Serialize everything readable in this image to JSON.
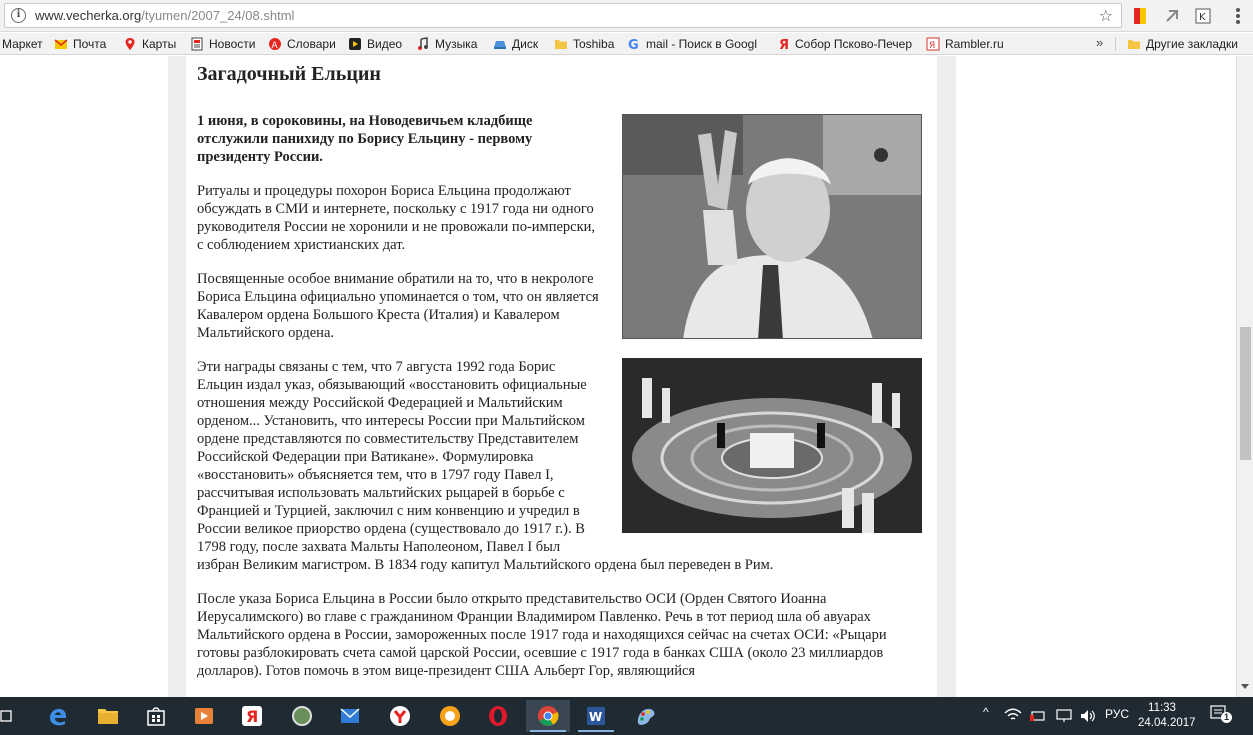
{
  "browser": {
    "url_host": "www.vecherka.org",
    "url_path": "/tyumen/2007_24/08.shtml"
  },
  "bookmarks": {
    "items": [
      {
        "label": "Маркет",
        "icon": "none"
      },
      {
        "label": "Почта",
        "icon": "mail-icon"
      },
      {
        "label": "Карты",
        "icon": "map-pin-icon"
      },
      {
        "label": "Новости",
        "icon": "news-icon"
      },
      {
        "label": "Словари",
        "icon": "dictionary-icon"
      },
      {
        "label": "Видео",
        "icon": "video-icon"
      },
      {
        "label": "Музыка",
        "icon": "music-icon"
      },
      {
        "label": "Диск",
        "icon": "disk-icon"
      },
      {
        "label": "Toshiba",
        "icon": "folder-icon"
      },
      {
        "label": "mail - Поиск в Googl",
        "icon": "google-icon"
      },
      {
        "label": "Собор Псково-Печер",
        "icon": "yandex-icon"
      },
      {
        "label": "Rambler.ru",
        "icon": "rambler-icon"
      }
    ],
    "more": "»",
    "other_label": "Другие закладки"
  },
  "article": {
    "title": "Загадочный Ельцин",
    "lead": "1 июня, в сороковины, на Новодевичьем кладбище отслужили панихиду по Борису Ельцину - первому президенту России.",
    "paragraphs": [
      "Ритуалы и процедуры похорон Бориса Ельцина продолжают обсуждать в СМИ и интернете, поскольку с 1917 года ни одного руководителя России не хоронили и не провожали по-имперски, с соблюдением христианских дат.",
      "Посвященные особое внимание обратили на то, что в некрологе Бориса Ельцина официально упоминается о том, что он является Кавалером ордена Большого Креста (Италия) и Кавалером Мальтийского ордена.",
      "Эти награды связаны с тем, что 7 августа 1992 года Борис Ельцин издал указ, обязывающий «восстановить официальные отношения между Российской Федерацией и Мальтийским орденом... Установить, что интересы России при Мальтийском ордене представляются по совместительству Представителем Российской Федерации при Ватикане». Формулировка «восстановить» объясняется тем, что в 1797 году Павел I, рассчитывая использовать мальтийских рыцарей в борьбе с Францией и Турцией, заключил с ним конвенцию и учредил в России великое приорство ордена (существовало до 1917 г.). В 1798 году, после захвата Мальты Наполеоном, Павел I был избран Великим магистром. В 1834 году капитул Мальтийского ордена был переведен в Рим.",
      "После указа Бориса Ельцина в России было открыто представительство ОСИ (Орден Святого Иоанна Иерусалимского) во главе с гражданином Франции Владимиром Павленко. Речь в тот период шла об авуарах Мальтийского ордена в России, замороженных после 1917 года и находящихся сейчас на счетах ОСИ: «Рыцари готовы разблокировать счета самой царской России, осевшие с 1917 года в банках США (около 23 миллиардов долларов). Готов помочь в этом вице-президент США Альберт Гор, являющийся"
    ]
  },
  "taskbar": {
    "language": "РУС",
    "time": "11:33",
    "date": "24.04.2017",
    "notifications": "1"
  },
  "colors": {
    "taskbar": "#1f2a33",
    "page_side": "#eeeeee",
    "bookmarks_bar": "#f2f2f2"
  }
}
